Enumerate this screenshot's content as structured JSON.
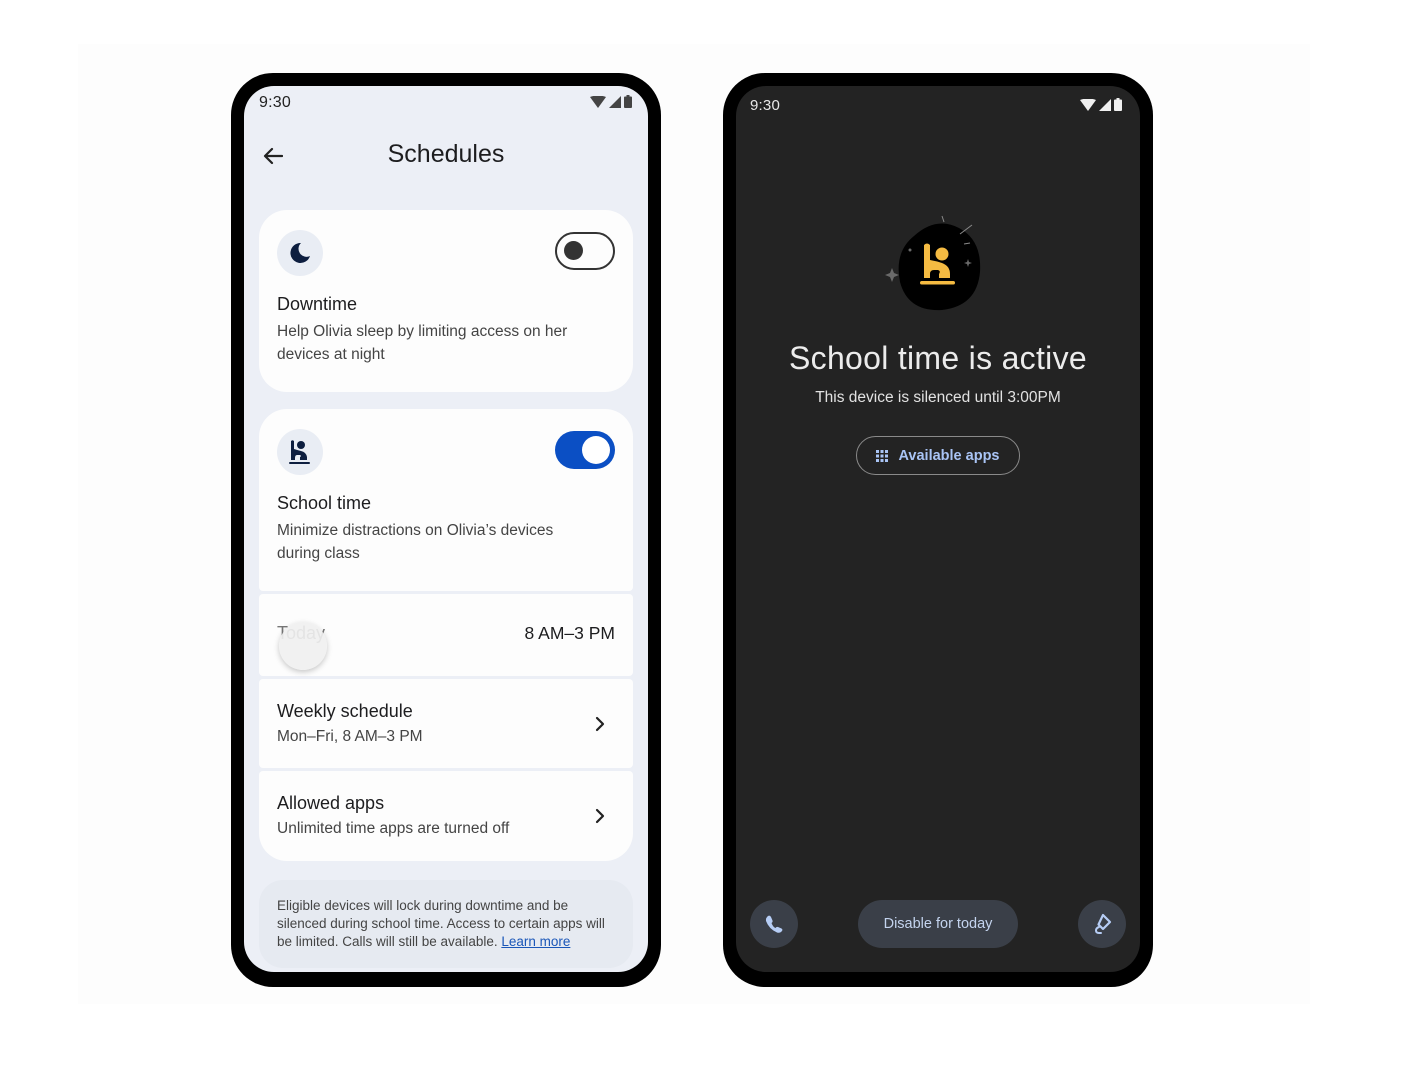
{
  "left_phone": {
    "status_bar": {
      "time": "9:30",
      "icons": [
        "wifi-icon",
        "signal-icon",
        "battery-icon"
      ]
    },
    "app_bar": {
      "title": "Schedules",
      "back_icon": "arrow-back-icon"
    },
    "downtime": {
      "icon": "moon-icon",
      "title": "Downtime",
      "description": "Help Olivia sleep by limiting access on her devices at night",
      "toggle_on": false
    },
    "school_time": {
      "icon": "raised-hand-student-icon",
      "title": "School time",
      "description": "Minimize distractions on Olivia’s devices during class",
      "toggle_on": true,
      "accent_color": "#0b4fc4"
    },
    "today": {
      "label": "Today",
      "value": "8 AM–3 PM"
    },
    "weekly_schedule": {
      "label": "Weekly schedule",
      "sub": "Mon–Fri, 8 AM–3 PM"
    },
    "allowed_apps": {
      "label": "Allowed apps",
      "sub": "Unlimited time apps are turned off"
    },
    "info": {
      "text": "Eligible devices will lock during downtime and be silenced during school time. Access to certain apps will be limited. Calls will still be available. ",
      "link": "Learn more"
    }
  },
  "right_phone": {
    "status_bar": {
      "time": "9:30",
      "icons": [
        "wifi-icon",
        "signal-icon",
        "battery-icon"
      ]
    },
    "illustration": {
      "icon": "raised-hand-student-icon",
      "accent_color": "#f5bb42"
    },
    "title": "School time is active",
    "subtitle": "This device is silenced until 3:00PM",
    "available_apps_button": {
      "label": "Available apps",
      "icon": "apps-grid-icon"
    },
    "bottom_bar": {
      "phone_icon": "phone-icon",
      "disable_label": "Disable for today",
      "rotate_icon": "screen-rotate-icon"
    }
  }
}
